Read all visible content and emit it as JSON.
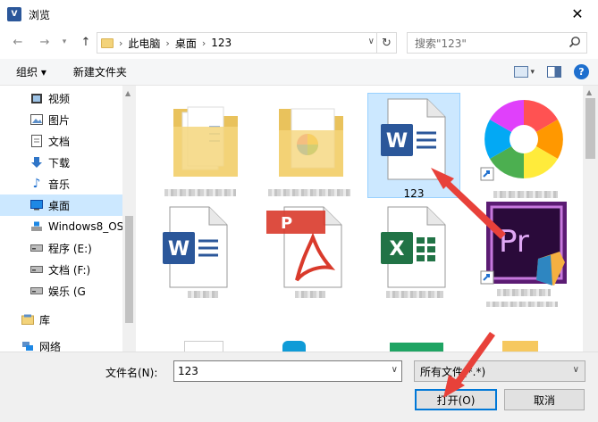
{
  "window": {
    "title": "浏览",
    "app_icon": "V"
  },
  "nav": {
    "breadcrumbs": [
      "此电脑",
      "桌面",
      "123"
    ],
    "search_placeholder": "搜索\"123\""
  },
  "toolbar": {
    "organize": "组织 ▾",
    "new_folder": "新建文件夹"
  },
  "sidebar": {
    "items": [
      {
        "label": "视频",
        "icon": "video-icon"
      },
      {
        "label": "图片",
        "icon": "picture-icon"
      },
      {
        "label": "文档",
        "icon": "document-icon"
      },
      {
        "label": "下载",
        "icon": "download-icon"
      },
      {
        "label": "音乐",
        "icon": "music-icon"
      },
      {
        "label": "桌面",
        "icon": "desktop-icon",
        "selected": true
      },
      {
        "label": "Windows8_OS",
        "icon": "drive-icon"
      },
      {
        "label": "程序 (E:)",
        "icon": "drive-icon"
      },
      {
        "label": "文档 (F:)",
        "icon": "drive-icon"
      },
      {
        "label": "娱乐 (G",
        "icon": "drive-icon"
      },
      {
        "label": "库",
        "icon": "library-icon"
      },
      {
        "label": "网络",
        "icon": "network-icon"
      }
    ]
  },
  "files": [
    {
      "label": "",
      "kind": "folder",
      "selected": false
    },
    {
      "label": "",
      "kind": "folder-image",
      "selected": false
    },
    {
      "label": "123",
      "kind": "word",
      "selected": true
    },
    {
      "label": "",
      "kind": "app-shortcut",
      "selected": false
    },
    {
      "label": "",
      "kind": "word",
      "selected": false
    },
    {
      "label": "",
      "kind": "pdf",
      "selected": false
    },
    {
      "label": "",
      "kind": "excel",
      "selected": false
    },
    {
      "label": "",
      "kind": "premiere-shortcut",
      "selected": false
    }
  ],
  "bottom": {
    "filename_label": "文件名(N):",
    "filename_value": "123",
    "filetype_value": "所有文件(*.*)",
    "open_button": "打开(O)",
    "cancel_button": "取消"
  },
  "colors": {
    "accent": "#0078d7",
    "selection": "#cce8ff",
    "word_blue": "#2b579a",
    "excel_green": "#217346",
    "pdf_red": "#d93a2b",
    "premiere_purple": "#7b2c8e",
    "arrow_red": "#e8413a"
  }
}
